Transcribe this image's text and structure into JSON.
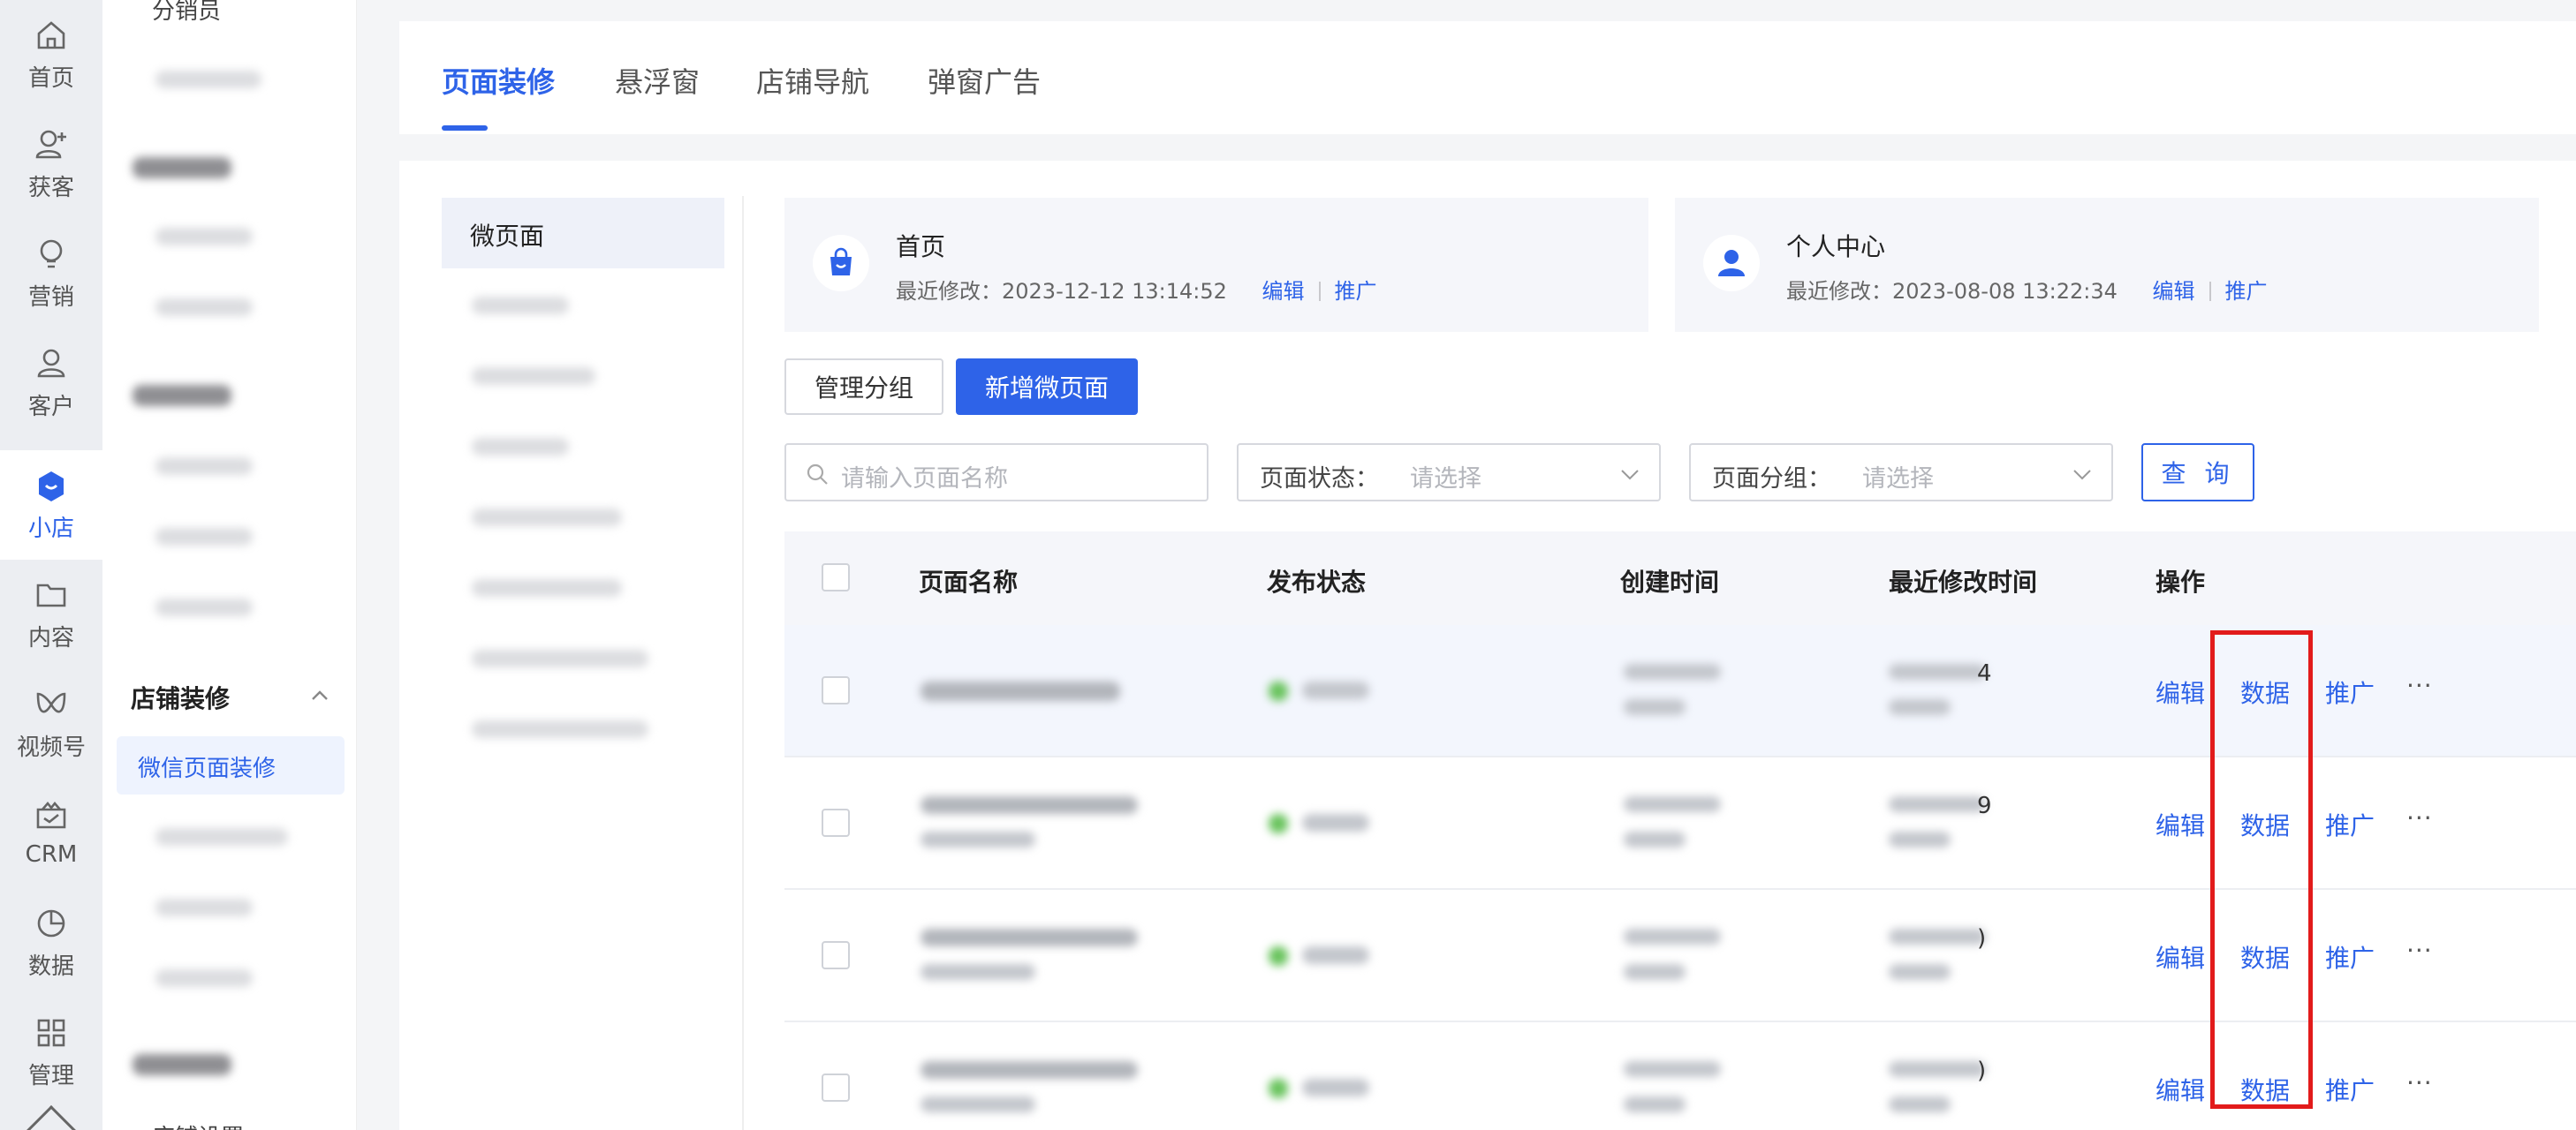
{
  "rail": [
    {
      "label": "首页",
      "icon": "home-icon"
    },
    {
      "label": "获客",
      "icon": "user-add-icon"
    },
    {
      "label": "营销",
      "icon": "bulb-icon"
    },
    {
      "label": "客户",
      "icon": "user-icon"
    },
    {
      "label": "小店",
      "icon": "shop-bag-icon",
      "active": true
    },
    {
      "label": "内容",
      "icon": "folder-icon"
    },
    {
      "label": "视频号",
      "icon": "channels-icon"
    },
    {
      "label": "CRM",
      "icon": "crm-icon"
    },
    {
      "label": "数据",
      "icon": "pie-chart-icon"
    },
    {
      "label": "管理",
      "icon": "grid-icon"
    }
  ],
  "subnav": {
    "top_item": "分销员",
    "section_title": "店铺装修",
    "selected_item": "微信页面装修",
    "bottom_item": "店铺设置"
  },
  "tabs": [
    "页面装修",
    "悬浮窗",
    "店铺导航",
    "弹窗广告"
  ],
  "groups": {
    "selected": "微页面"
  },
  "cards": [
    {
      "title": "首页",
      "modified_label": "最近修改：",
      "modified": "2023-12-12 13:14:52",
      "edit": "编辑",
      "promote": "推广"
    },
    {
      "title": "个人中心",
      "modified_label": "最近修改：",
      "modified": "2023-08-08 13:22:34",
      "edit": "编辑",
      "promote": "推广"
    }
  ],
  "actions": {
    "manage_groups": "管理分组",
    "new_page": "新增微页面"
  },
  "filters": {
    "search_placeholder": "请输入页面名称",
    "status_label": "页面状态：",
    "status_placeholder": "请选择",
    "group_label": "页面分组：",
    "group_placeholder": "请选择",
    "query": "查 询"
  },
  "table": {
    "columns": [
      "页面名称",
      "发布状态",
      "创建时间",
      "最近修改时间",
      "操作"
    ],
    "row_ops": [
      "编辑",
      "数据",
      "推广"
    ],
    "more": "···",
    "row_tails": [
      "4",
      "9",
      ")",
      ")"
    ]
  },
  "colors": {
    "accent": "#2e63e8",
    "highlight": "#e21b1b"
  }
}
